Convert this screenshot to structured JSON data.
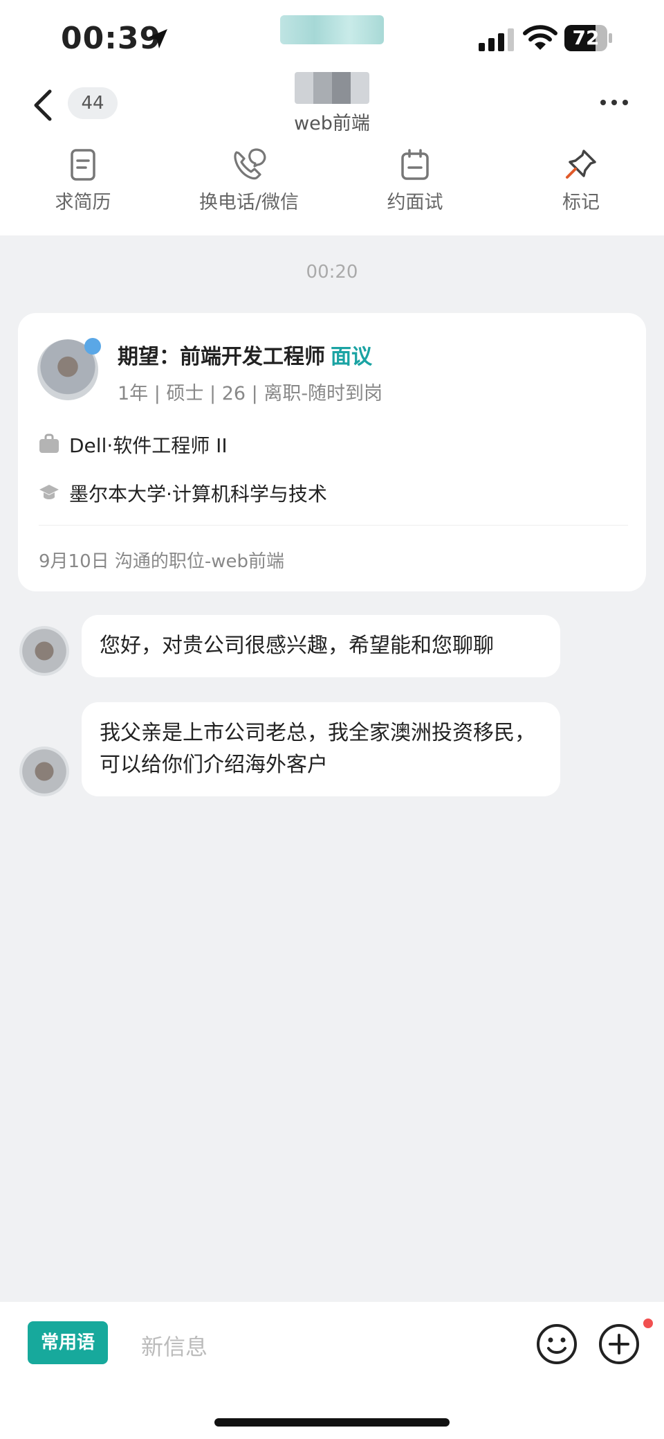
{
  "status_bar": {
    "time": "00:39",
    "battery": "72",
    "battery_level": 0.72
  },
  "header": {
    "badge_count": "44",
    "subtitle": "web前端"
  },
  "actions": [
    {
      "label": "求简历",
      "icon": "resume-icon"
    },
    {
      "label": "换电话/微信",
      "icon": "phone-wechat-icon"
    },
    {
      "label": "约面试",
      "icon": "calendar-icon"
    },
    {
      "label": "标记",
      "icon": "pin-icon"
    }
  ],
  "chat": {
    "timestamp": "00:20",
    "profile_card": {
      "expect_label": "期望：前端开发工程师",
      "salary": "面议",
      "meta": "1年 | 硕士 | 26 | 离职-随时到岗",
      "work": "Dell·软件工程师 II",
      "education": "墨尔本大学·计算机科学与技术",
      "footer": "9月10日 沟通的职位-web前端"
    },
    "messages": [
      {
        "text": "您好，对贵公司很感兴趣，希望能和您聊聊"
      },
      {
        "text": "我父亲是上市公司老总，我全家澳洲投资移民，可以给你们介绍海外客户"
      }
    ]
  },
  "input_bar": {
    "phrases_label": "常用语",
    "placeholder": "新信息"
  },
  "colors": {
    "accent": "#1aa3a3",
    "button": "#17a99c",
    "background": "#f0f1f3",
    "notification": "#f15050"
  }
}
